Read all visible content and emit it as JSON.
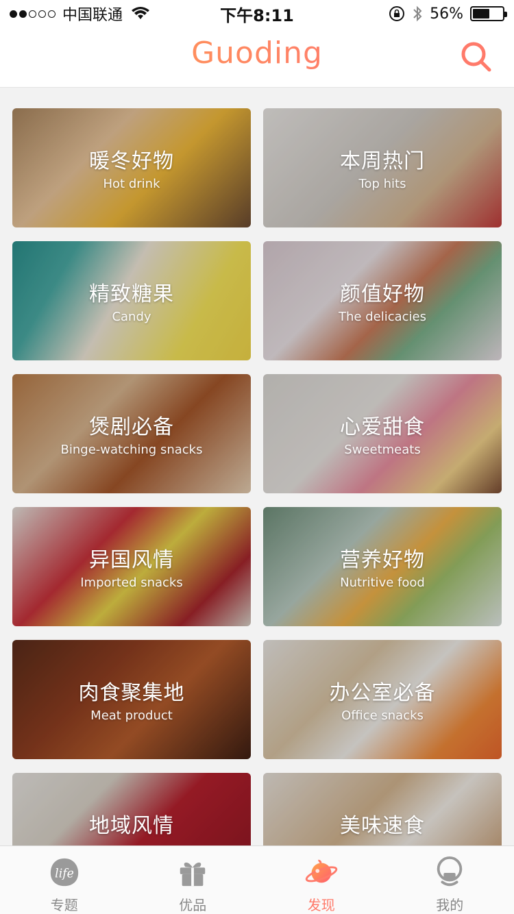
{
  "status_bar": {
    "signal_dots_filled": 2,
    "signal_dots_total": 5,
    "carrier": "中国联通",
    "time": "下午8:11",
    "battery": "56%",
    "battery_level": 0.56
  },
  "header": {
    "logo": "Guoding",
    "search_icon": "search-icon"
  },
  "colors": {
    "accent": "#ff7a6a",
    "logo_start": "#ffa24a",
    "logo_end": "#ff6b7b"
  },
  "categories": [
    {
      "title": "暖冬好物",
      "subtitle": "Hot drink",
      "bg": "linear-gradient(135deg,#a9855e 0%,#e8c49a 35%,#f0b93a 60%,#6b4a32 100%)"
    },
    {
      "title": "本周热门",
      "subtitle": "Top hits",
      "bg": "linear-gradient(135deg,#e9e6e3 0%,#cfcac4 45%,#d5b793 70%,#c23b3b 100%)"
    },
    {
      "title": "精致糖果",
      "subtitle": "Candy",
      "bg": "linear-gradient(120deg,#2a8f8c 0%,#4aa9a3 22%,#efe7d8 45%,#f4e35a 75%,#f1d64a 100%)"
    },
    {
      "title": "颜值好物",
      "subtitle": "The delicacies",
      "bg": "linear-gradient(135deg,#d8c9cf 0%,#e9e1e4 35%,#c97b5a 55%,#7bb08a 70%,#e7dde3 100%)"
    },
    {
      "title": "煲剧必备",
      "subtitle": "Binge-watching snacks",
      "bg": "linear-gradient(135deg,#b77b48 0%,#d7b48e 35%,#a4562a 60%,#e6cfb3 100%)"
    },
    {
      "title": "心爱甜食",
      "subtitle": "Sweetmeats",
      "bg": "linear-gradient(135deg,#d9d6d2 0%,#e7e3df 40%,#e88fa0 60%,#f1d18a 80%,#7a4b33 100%)"
    },
    {
      "title": "异国风情",
      "subtitle": "Imported snacks",
      "bg": "linear-gradient(135deg,#e7e2dc 0%,#c8323b 35%,#e7d34a 55%,#a6262d 80%,#d9d2c8 100%)"
    },
    {
      "title": "营养好物",
      "subtitle": "Nutritive food",
      "bg": "linear-gradient(135deg,#6f8f7a 0%,#b9cbc1 35%,#f0b24a 55%,#9fbf6a 70%,#e3e9e6 100%)"
    },
    {
      "title": "肉食聚集地",
      "subtitle": "Meat product",
      "bg": "linear-gradient(135deg,#5a2c1a 0%,#8d3d20 35%,#b45c2c 60%,#3f1f13 100%)"
    },
    {
      "title": "办公室必备",
      "subtitle": "Office snacks",
      "bg": "linear-gradient(135deg,#e9e6e2 0%,#d8c3a3 35%,#f1eee9 55%,#f08a3a 80%,#e9672d 100%)"
    },
    {
      "title": "地域风情",
      "subtitle": "",
      "bg": "linear-gradient(135deg,#e6e3df 0%,#d8d1c6 30%,#b5202d 55%,#8d1622 100%)"
    },
    {
      "title": "美味速食",
      "subtitle": "",
      "bg": "linear-gradient(135deg,#e7e1da 0%,#d2b48f 40%,#f2ede6 60%,#b88552 100%)"
    }
  ],
  "tabs": [
    {
      "label": "专题",
      "icon": "life-icon",
      "active": false
    },
    {
      "label": "优品",
      "icon": "gift-icon",
      "active": false
    },
    {
      "label": "发现",
      "icon": "planet-icon",
      "active": true
    },
    {
      "label": "我的",
      "icon": "profile-icon",
      "active": false
    }
  ]
}
